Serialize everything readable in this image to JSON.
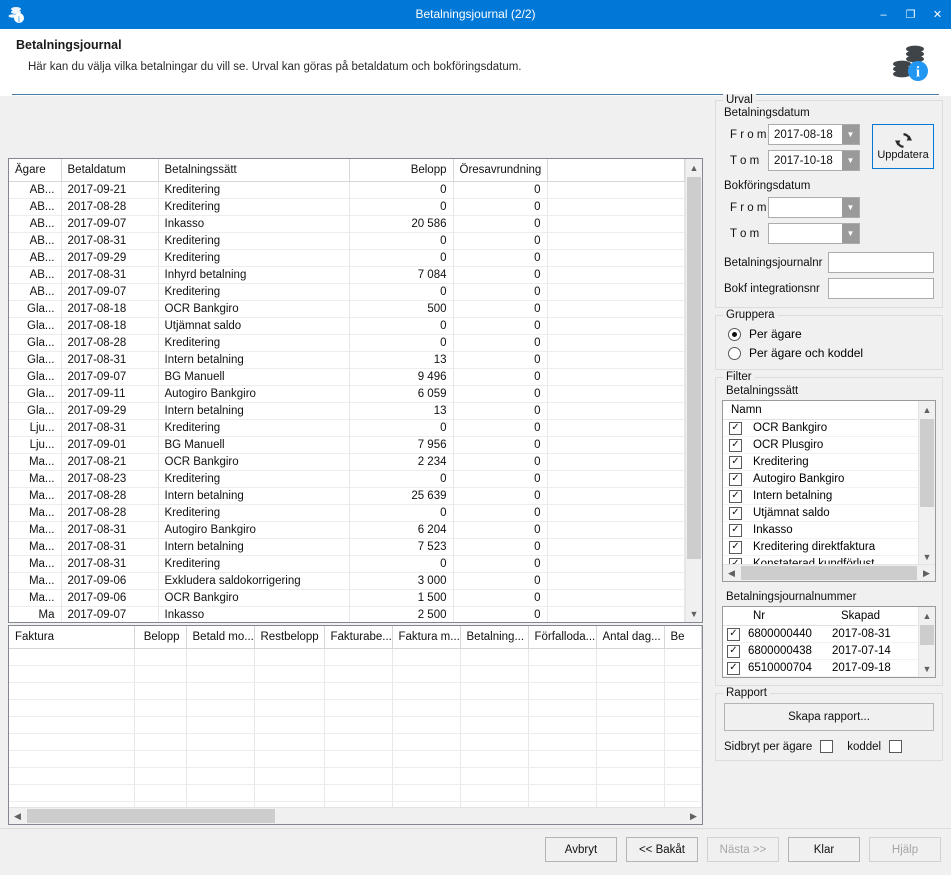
{
  "window": {
    "title": "Betalningsjournal (2/2)",
    "icon": "coins-info-icon",
    "minimize": "–",
    "maximize": "❐",
    "close": "✕",
    "accent": "#0078d7"
  },
  "header": {
    "title": "Betalningsjournal",
    "subtitle": "Här kan du välja vilka betalningar du vill se. Urval kan göras på betaldatum och bokföringsdatum.",
    "icon": "coins-info-icon"
  },
  "main_grid": {
    "columns": [
      "Ägare",
      "Betaldatum",
      "Betalningssätt",
      "Belopp",
      "Öresavrundning",
      ""
    ],
    "rows": [
      [
        "AB...",
        "2017-09-21",
        "Kreditering",
        "0",
        "0"
      ],
      [
        "AB...",
        "2017-08-28",
        "Kreditering",
        "0",
        "0"
      ],
      [
        "AB...",
        "2017-09-07",
        "Inkasso",
        "20 586",
        "0"
      ],
      [
        "AB...",
        "2017-08-31",
        "Kreditering",
        "0",
        "0"
      ],
      [
        "AB...",
        "2017-09-29",
        "Kreditering",
        "0",
        "0"
      ],
      [
        "AB...",
        "2017-08-31",
        "Inhyrd betalning",
        "7 084",
        "0"
      ],
      [
        "AB...",
        "2017-09-07",
        "Kreditering",
        "0",
        "0"
      ],
      [
        "Gla...",
        "2017-08-18",
        "OCR Bankgiro",
        "500",
        "0"
      ],
      [
        "Gla...",
        "2017-08-18",
        "Utjämnat saldo",
        "0",
        "0"
      ],
      [
        "Gla...",
        "2017-08-28",
        "Kreditering",
        "0",
        "0"
      ],
      [
        "Gla...",
        "2017-08-31",
        "Intern betalning",
        "13",
        "0"
      ],
      [
        "Gla...",
        "2017-09-07",
        "BG Manuell",
        "9 496",
        "0"
      ],
      [
        "Gla...",
        "2017-09-11",
        "Autogiro Bankgiro",
        "6 059",
        "0"
      ],
      [
        "Gla...",
        "2017-09-29",
        "Intern betalning",
        "13",
        "0"
      ],
      [
        "Lju...",
        "2017-08-31",
        "Kreditering",
        "0",
        "0"
      ],
      [
        "Lju...",
        "2017-09-01",
        "BG Manuell",
        "7 956",
        "0"
      ],
      [
        "Ma...",
        "2017-08-21",
        "OCR Bankgiro",
        "2 234",
        "0"
      ],
      [
        "Ma...",
        "2017-08-23",
        "Kreditering",
        "0",
        "0"
      ],
      [
        "Ma...",
        "2017-08-28",
        "Intern betalning",
        "25 639",
        "0"
      ],
      [
        "Ma...",
        "2017-08-28",
        "Kreditering",
        "0",
        "0"
      ],
      [
        "Ma...",
        "2017-08-31",
        "Autogiro Bankgiro",
        "6 204",
        "0"
      ],
      [
        "Ma...",
        "2017-08-31",
        "Intern betalning",
        "7 523",
        "0"
      ],
      [
        "Ma...",
        "2017-08-31",
        "Kreditering",
        "0",
        "0"
      ],
      [
        "Ma...",
        "2017-09-06",
        "Exkludera saldokorrigering",
        "3 000",
        "0"
      ],
      [
        "Ma...",
        "2017-09-06",
        "OCR Bankgiro",
        "1 500",
        "0"
      ],
      [
        "Ma",
        "2017-09-07",
        "Inkasso",
        "2 500",
        "0"
      ]
    ]
  },
  "detail_grid": {
    "columns": [
      "Faktura",
      "Belopp",
      "Betald mo...",
      "Restbelopp",
      "Fakturabe...",
      "Faktura m...",
      "Betalning...",
      "Förfalloda...",
      "Antal dag...",
      "Be"
    ],
    "rows": []
  },
  "urval": {
    "legend": "Urval",
    "betalningsdatum_label": "Betalningsdatum",
    "from_label": "F r o m",
    "tom_label": "T o m",
    "betalningsdatum_from": "2017-08-18",
    "betalningsdatum_tom": "2017-10-18",
    "bokforingsdatum_label": "Bokföringsdatum",
    "bokforingsdatum_from": "",
    "bokforingsdatum_tom": "",
    "journalnr_label": "Betalningsjournalnr",
    "journalnr_value": "",
    "integrationsnr_label": "Bokf integrationsnr",
    "integrationsnr_value": "",
    "update_button": "Uppdatera",
    "update_icon": "refresh-icon"
  },
  "gruppera": {
    "legend": "Gruppera",
    "options": [
      {
        "label": "Per ägare",
        "selected": true
      },
      {
        "label": "Per ägare och koddel",
        "selected": false
      }
    ]
  },
  "filter": {
    "legend": "Filter",
    "betalningssatt_label": "Betalningssätt",
    "list_header": "Namn",
    "items": [
      {
        "label": "OCR Bankgiro",
        "checked": true
      },
      {
        "label": "OCR Plusgiro",
        "checked": true
      },
      {
        "label": "Kreditering",
        "checked": true
      },
      {
        "label": "Autogiro Bankgiro",
        "checked": true
      },
      {
        "label": "Intern betalning",
        "checked": true
      },
      {
        "label": "Utjämnat saldo",
        "checked": true
      },
      {
        "label": "Inkasso",
        "checked": true
      },
      {
        "label": "Kreditering direktfaktura",
        "checked": true
      },
      {
        "label": "Konstaterad kundförlust",
        "checked": true
      }
    ],
    "journalnummer_label": "Betalningsjournalnummer",
    "journal_columns": [
      "Nr",
      "Skapad",
      ""
    ],
    "journal_rows": [
      {
        "checked": true,
        "nr": "6800000440",
        "skapad": "2017-08-31"
      },
      {
        "checked": true,
        "nr": "6800000438",
        "skapad": "2017-07-14"
      },
      {
        "checked": true,
        "nr": "6510000704",
        "skapad": "2017-09-18"
      }
    ]
  },
  "rapport": {
    "legend": "Rapport",
    "create_button": "Skapa rapport...",
    "sidbryt_label": "Sidbryt per ägare",
    "sidbryt_checked": false,
    "koddel_label": "koddel",
    "koddel_checked": false
  },
  "footer": {
    "buttons": [
      {
        "label": "Avbryt",
        "disabled": false
      },
      {
        "label": "<< Bakåt",
        "disabled": false
      },
      {
        "label": "Nästa >>",
        "disabled": true
      },
      {
        "label": "Klar",
        "disabled": false
      },
      {
        "label": "Hjälp",
        "disabled": true
      }
    ]
  }
}
